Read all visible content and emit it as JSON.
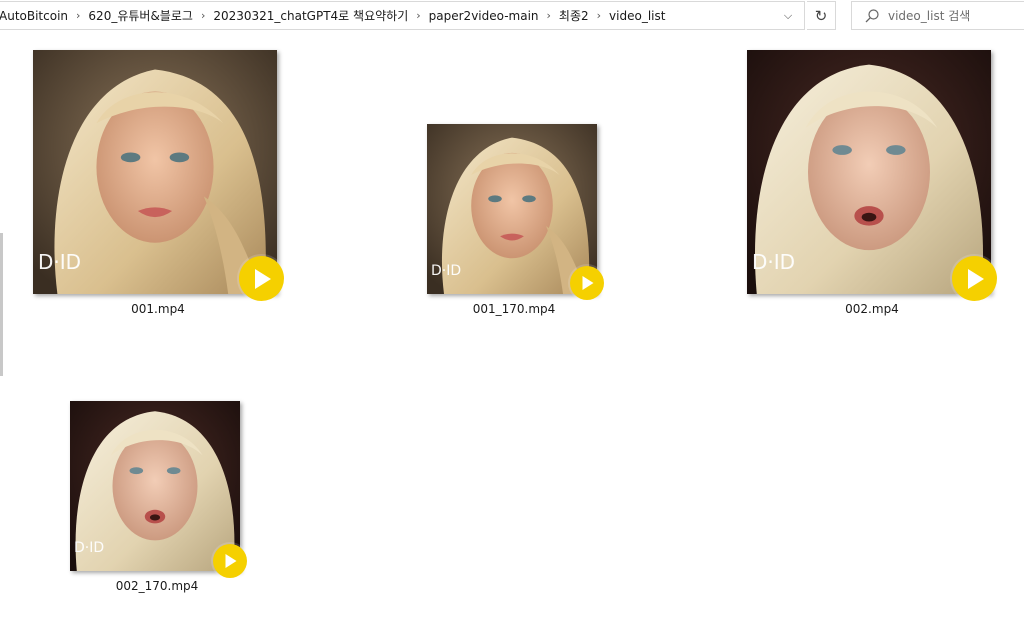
{
  "address_bar": {
    "crumbs": [
      "AutoBitcoin",
      "620_유튜버&블로그",
      "20230321_chatGPT4로 책요약하기",
      "paper2video-main",
      "최종2",
      "video_list"
    ],
    "separator": "›",
    "dropdown_glyph": "⌵",
    "refresh_glyph": "↻"
  },
  "search": {
    "placeholder": "video_list 검색"
  },
  "files": [
    {
      "name": "001.mp4",
      "logo": "D·ID"
    },
    {
      "name": "001_170.mp4",
      "logo": "D·ID"
    },
    {
      "name": "002.mp4",
      "logo": "D·ID"
    },
    {
      "name": "002_170.mp4",
      "logo": "D·ID"
    }
  ],
  "colors": {
    "play_badge": "#f5d000",
    "border": "#d9d9d9"
  },
  "icons": [
    "search-icon",
    "refresh-icon",
    "chevron-down-icon",
    "play-icon"
  ]
}
